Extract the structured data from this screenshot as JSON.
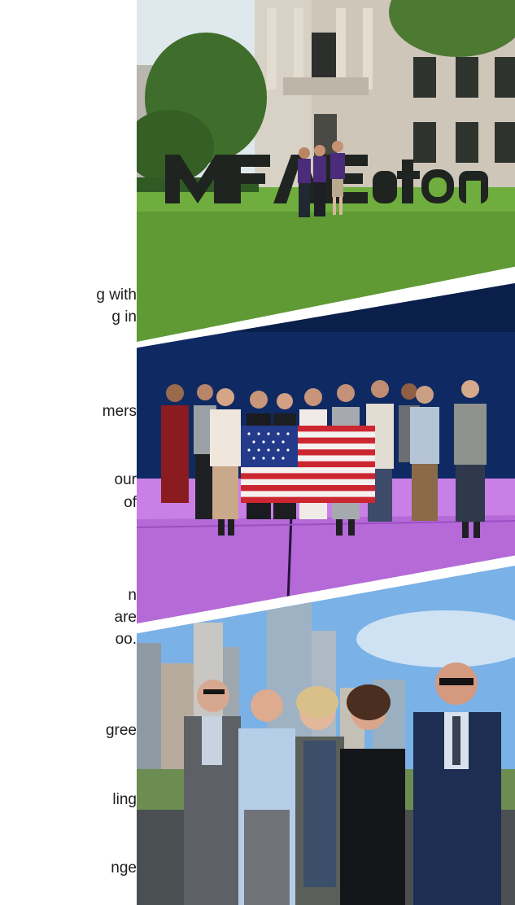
{
  "article_fragments": [
    "g with",
    "g in",
    "mers",
    "our",
    "of",
    "n",
    "are",
    "oo.",
    "gree",
    "ling",
    "nge"
  ],
  "photos": {
    "museum": {
      "sign_text": "MFABoston",
      "colors": {
        "sky": "#dfe8ec",
        "lawn": "#5f9a35",
        "stone": "#cdc6b9",
        "letters": "#1f2420",
        "shirt": "#4b2c7a"
      }
    },
    "stage": {
      "colors": {
        "backdrop": "#0f2a62",
        "floor": "#c980e6",
        "flag_red": "#cc2630",
        "flag_blue": "#233b8a"
      }
    },
    "city": {
      "colors": {
        "sky": "#7ab1e6",
        "tower": "#9fb2c4",
        "suit": "#1e2d52",
        "shirt": "#b6cde8"
      }
    }
  }
}
